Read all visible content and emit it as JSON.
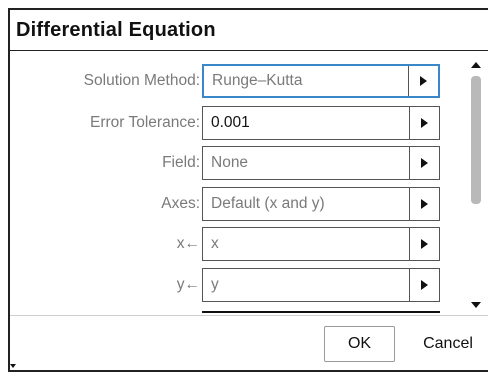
{
  "dialog": {
    "title": "Differential Equation",
    "fields": [
      {
        "label": "Solution Method:",
        "value": "Runge–Kutta",
        "focused": true
      },
      {
        "label": "Error Tolerance:",
        "value": "0.001",
        "focused": false
      },
      {
        "label": "Field:",
        "value": "None",
        "focused": false
      },
      {
        "label": "Axes:",
        "value": "Default (x and y)",
        "focused": false
      },
      {
        "label": "x←",
        "value": "x",
        "focused": false
      },
      {
        "label": "y←",
        "value": "y",
        "focused": false
      }
    ],
    "buttons": {
      "ok": "OK",
      "cancel": "Cancel"
    }
  },
  "colors": {
    "focus_border": "#3a87c9",
    "label_text": "#7a7a7a",
    "scroll_thumb": "#b9b9b9"
  },
  "icons": {
    "dropdown": "triangle-right-icon",
    "scroll_up": "triangle-up-icon",
    "scroll_down": "triangle-down-icon"
  }
}
